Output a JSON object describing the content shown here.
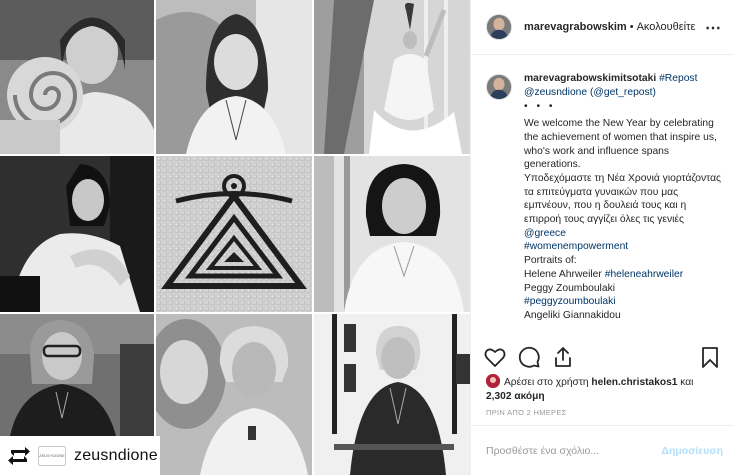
{
  "post": {
    "username": "marevagrabowskim",
    "follow_label": "Ακολουθείτε",
    "more_label": "⋯"
  },
  "repost": {
    "username": "zeusndione",
    "logo_text": "ZEUS+DIONE"
  },
  "caption": {
    "username": "marevagrabowskimitsotaki",
    "repost_tag": "#Repost",
    "source_mention": "@zeusndione",
    "get_repost": "(@get_repost)",
    "dots": "• • •",
    "english_text": "We welcome the New Year by celebrating the achievement of women that inspire us, who's work and influence spans generations.",
    "greek_text": "Υποδεχόμαστε τη Νέα Χρονιά γιορτάζοντας τα επιτεύγματα γυναικών που μας εμπνέουν, που η δουλειά τους και η επιρροή τους αγγίζει όλες τις γενιές",
    "mention_greece": "@greece",
    "hashtag_women": "#womenempowerment",
    "portraits_label": "Portraits of:",
    "person1": "Helene Ahrweiler",
    "hashtag1": "#heleneahrweiler",
    "person2": "Peggy Zoumboulaki",
    "hashtag2": "#peggyzoumboulaki",
    "person3": "Angeliki Giannakidou"
  },
  "actions": {
    "like_icon": "heart-icon",
    "comment_icon": "comment-icon",
    "share_icon": "share-icon",
    "save_icon": "bookmark-icon"
  },
  "likes": {
    "prefix": "Αρέσει στο χρήστη",
    "user": "helen.christakos1",
    "conj": "και",
    "count": "2,302 ακόμη"
  },
  "timestamp": "ΠΡΙΝ ΑΠΟ 2 ΗΜΕΡΕΣ",
  "comment": {
    "placeholder": "Προσθέστε ένα σχόλιο...",
    "post_label": "Δημοσίευση"
  }
}
